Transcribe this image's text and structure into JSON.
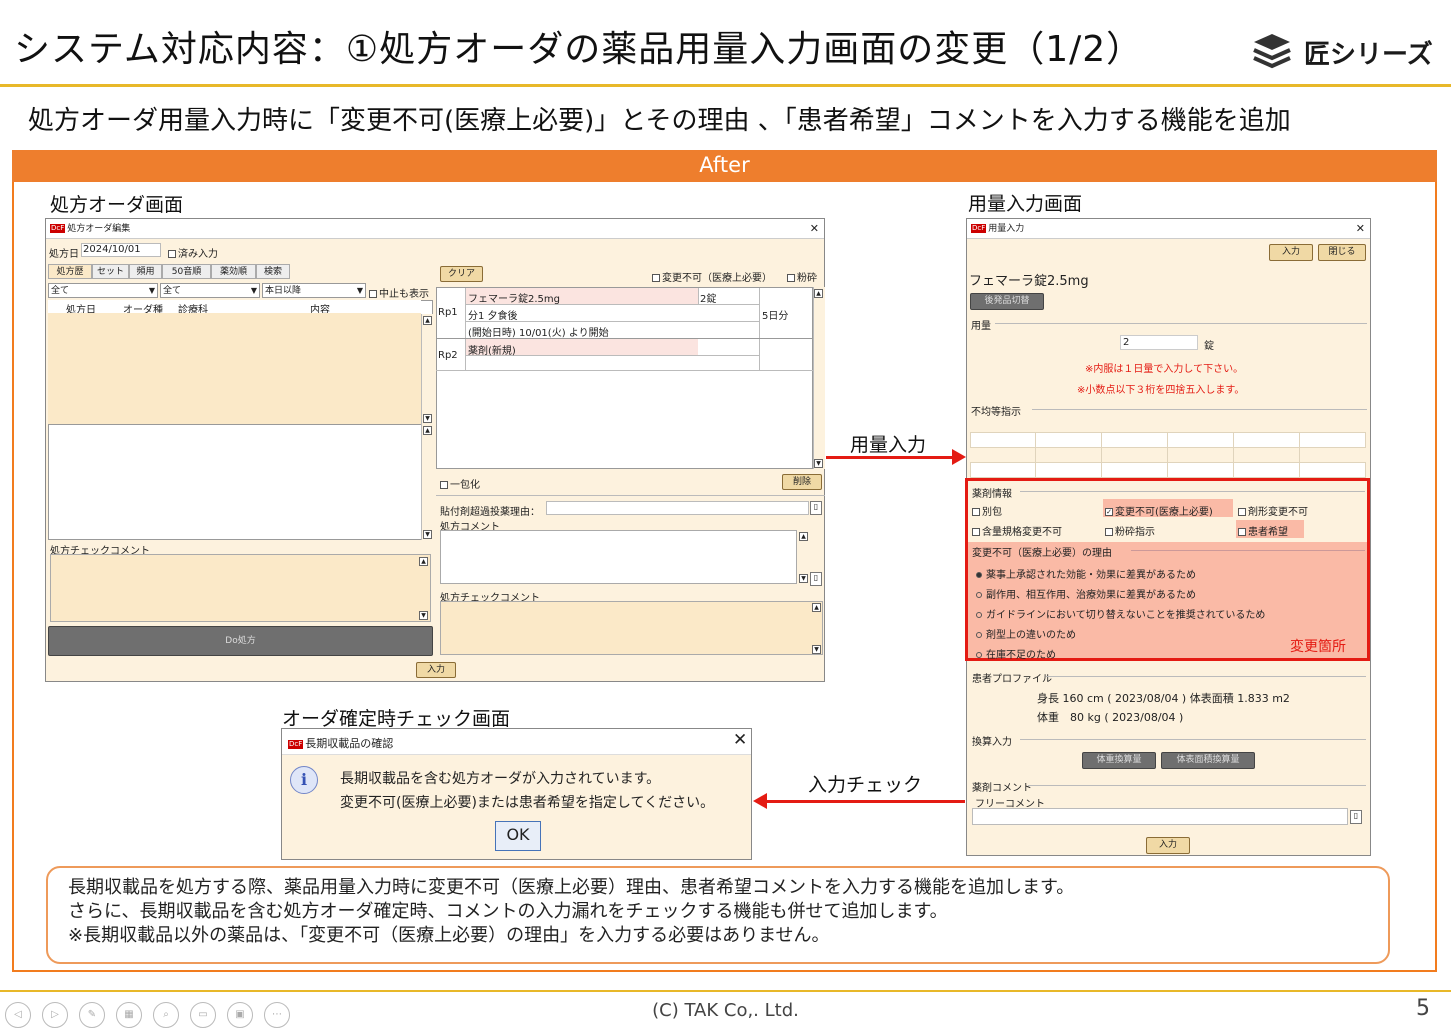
{
  "slide": {
    "title": "システム対応内容：①処方オーダの薬品用量入力画面の変更（1/2）",
    "brand": "匠シリーズ",
    "subtitle": "処方オーダ用量入力時に「変更不可(医療上必要)」とその理由 、「患者希望」コメントを入力する機能を追加",
    "after_label": "After",
    "label_order_screen": "処方オーダ画面",
    "label_dose_screen": "用量入力画面",
    "label_check_screen": "オーダ確定時チェック画面",
    "arrow_dose_input": "用量入力",
    "arrow_input_check": "入力チェック",
    "note_lines": [
      "長期収載品を処方する際、薬品用量入力時に変更不可（医療上必要）理由、患者希望コメントを入力する機能を追加します。",
      "さらに、長期収載品を含む処方オーダ確定時、コメントの入力漏れをチェックする機能も併せて追加します。",
      "※長期収載品以外の薬品は、「変更不可（医療上必要）の理由」を入力する必要はありません。"
    ],
    "footer": "(C) TAK Co,. Ltd.",
    "page_number": "5"
  },
  "order_window": {
    "title": "処方オーダ編集",
    "date_label": "処方日",
    "date_value": "2024/10/01",
    "done_input": "済み入力",
    "tabs": [
      "処方歴",
      "セット",
      "頻用",
      "50音順",
      "薬効順",
      "検索"
    ],
    "filter1": "全て",
    "filter2": "全て",
    "filter3": "本日以降",
    "show_stopped": "中止も表示",
    "columns": [
      "処方日",
      "オーダ種",
      "診療科",
      "内容"
    ],
    "check_comment": "処方チェックコメント",
    "do_button": "Do処方",
    "clear_button": "クリア",
    "no_change": "変更不可（医療上必要）",
    "powder": "粉砕",
    "rp1_label": "Rp1",
    "rp1_drug": "フェマーラ錠2.5mg",
    "rp1_qty": "2錠",
    "rp1_usage": "分1 夕食後",
    "rp1_days": "5日分",
    "rp1_start": "(開始日時) 10/01(火) より開始",
    "rp2_label": "Rp2",
    "rp2_drug": "薬剤(新規)",
    "one_pack": "一包化",
    "delete_button": "削除",
    "patch_reason": "貼付剤超過投薬理由：",
    "rx_comment": "処方コメント",
    "rx_check_comment": "処方チェックコメント",
    "enter_button": "入力"
  },
  "dose_window": {
    "title": "用量入力",
    "enter_button": "入力",
    "close_button": "閉じる",
    "drug_name": "フェマーラ錠2.5mg",
    "generic_switch": "後発品切替",
    "dose_label": "用量",
    "dose_value": "2",
    "dose_unit": "錠",
    "note1": "※内服は１日量で入力して下さい。",
    "note2": "※小数点以下３桁を四捨五入します。",
    "uneven_label": "不均等指示",
    "drug_info": "薬剤情報",
    "cb_separate": "別包",
    "cb_no_change": "変更不可(医療上必要)",
    "cb_form_change": "剤形変更不可",
    "cb_strength": "含量規格変更不可",
    "cb_powder": "粉砕指示",
    "cb_patient": "患者希望",
    "reason_label": "変更不可（医療上必要）の理由",
    "reasons": [
      "薬事上承認された効能・効果に差異があるため",
      "副作用、相互作用、治療効果に差異があるため",
      "ガイドラインにおいて切り替えないことを推奨されているため",
      "剤型上の違いのため",
      "在庫不足のため"
    ],
    "changed_label": "変更箇所",
    "profile_label": "患者プロファイル",
    "height_line": "身長 160 cm ( 2023/08/04 ) 体表面積 1.833 m2",
    "weight_line": "体重　80 kg ( 2023/08/04 )",
    "conv_label": "換算入力",
    "conv_btn1": "体重換算量",
    "conv_btn2": "体表面積換算量",
    "drug_comment": "薬剤コメント",
    "free_comment": "フリーコメント",
    "bottom_enter": "入力"
  },
  "check_dialog": {
    "title": "長期収載品の確認",
    "line1": "長期収載品を含む処方オーダが入力されています。",
    "line2": "変更不可(医療上必要)または患者希望を指定してください。",
    "ok": "OK"
  },
  "colors": {
    "accent_orange": "#ee7e2d",
    "gold_rule": "#e8b829",
    "highlight_red": "#e41b13",
    "highlight_fill": "#fabaa6"
  }
}
